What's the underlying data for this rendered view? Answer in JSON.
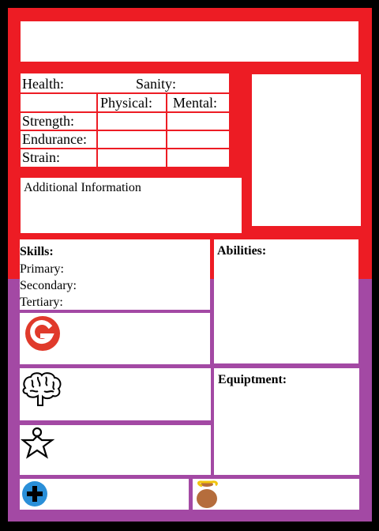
{
  "stats": {
    "health_label": "Health:",
    "sanity_label": "Sanity:",
    "col_physical": "Physical:",
    "col_mental": "Mental:",
    "rows": [
      "Strength:",
      "Endurance:",
      "Strain:"
    ]
  },
  "additional_info": {
    "label": "Additional Information"
  },
  "skills": {
    "label": "Skills:",
    "items": [
      "Primary:",
      "Secondary:",
      "Tertiary:"
    ]
  },
  "abilities": {
    "label": "Abilities:"
  },
  "equipment": {
    "label": "Equiptment:"
  },
  "icons": [
    "g-logo-icon",
    "brain-icon",
    "person-star-icon",
    "plus-icon",
    "money-bag-icon"
  ],
  "colors": {
    "frame_top": "#ed1c24",
    "frame_bottom": "#a349a4",
    "background": "#000000"
  }
}
